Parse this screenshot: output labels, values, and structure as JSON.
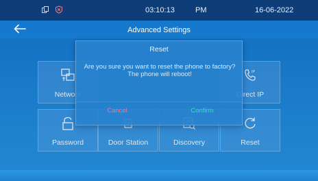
{
  "status_bar": {
    "time": "03:10:13",
    "ampm": "PM",
    "date": "16-06-2022",
    "left_icons": [
      "copy-icon",
      "shield-x-icon"
    ]
  },
  "header": {
    "title": "Advanced Settings",
    "back_icon": "back-arrow-icon"
  },
  "tiles": [
    {
      "label": "Network",
      "icon": "network-icon"
    },
    {
      "label": "Direct IP",
      "icon": "phone-ip-icon"
    },
    {
      "label": "Password",
      "icon": "lock-icon"
    },
    {
      "label": "Door Station",
      "icon": "door-station-icon"
    },
    {
      "label": "Discovery",
      "icon": "discovery-icon"
    },
    {
      "label": "Reset",
      "icon": "reset-icon"
    }
  ],
  "dialog": {
    "title": "Reset",
    "message": "Are you sure you want to reset the phone to factory? The phone will reboot!",
    "cancel_label": "Cancel",
    "confirm_label": "Confirm"
  },
  "colors": {
    "status_bar_bg": "#0f3d78",
    "background": "#1e86d6",
    "cancel": "#ff6f86",
    "confirm": "#34e3b0"
  }
}
